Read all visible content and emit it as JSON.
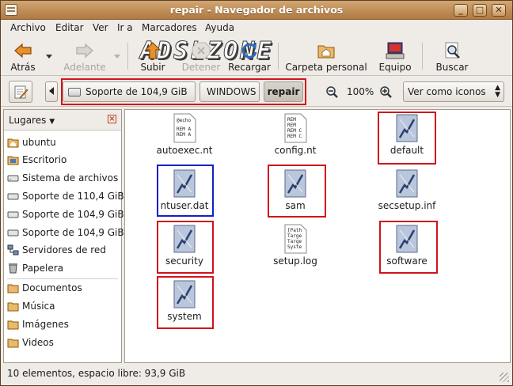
{
  "window": {
    "title": "repair - Navegador de archivos"
  },
  "watermark": "ADSLZONE",
  "menubar": {
    "items": [
      {
        "label": "Archivo"
      },
      {
        "label": "Editar"
      },
      {
        "label": "Ver"
      },
      {
        "label": "Ir a"
      },
      {
        "label": "Marcadores"
      },
      {
        "label": "Ayuda"
      }
    ]
  },
  "toolbar": {
    "back": "Atrás",
    "forward": "Adelante",
    "up": "Subir",
    "stop": "Detener",
    "reload": "Recargar",
    "home": "Carpeta personal",
    "computer": "Equipo",
    "search": "Buscar"
  },
  "location": {
    "path": [
      {
        "label": "Soporte de 104,9 GiB"
      },
      {
        "label": "WINDOWS"
      },
      {
        "label": "repair"
      }
    ],
    "zoom": "100%",
    "view_mode": "Ver como iconos"
  },
  "sidebar": {
    "header": "Lugares",
    "items": [
      {
        "label": "ubuntu",
        "icon": "home-folder-icon"
      },
      {
        "label": "Escritorio",
        "icon": "desktop-icon"
      },
      {
        "label": "Sistema de archivos",
        "icon": "drive-icon"
      },
      {
        "label": "Soporte de 110,4 GiB",
        "icon": "drive-icon"
      },
      {
        "label": "Soporte de 104,9 GiB",
        "icon": "drive-icon"
      },
      {
        "label": "Soporte de 104,9 GiB",
        "icon": "drive-icon"
      },
      {
        "label": "Servidores de red",
        "icon": "network-icon"
      },
      {
        "label": "Papelera",
        "icon": "trash-icon"
      },
      {
        "label": "Documentos",
        "icon": "folder-icon"
      },
      {
        "label": "Música",
        "icon": "folder-icon"
      },
      {
        "label": "Imágenes",
        "icon": "folder-icon"
      },
      {
        "label": "Videos",
        "icon": "folder-icon"
      }
    ]
  },
  "files": [
    {
      "name": "autoexec.nt",
      "type": "text",
      "preview": "@echo|REM A|REM A"
    },
    {
      "name": "config.nt",
      "type": "text",
      "preview": "REM|REM|REM C|REM C"
    },
    {
      "name": "default",
      "type": "hive"
    },
    {
      "name": "ntuser.dat",
      "type": "hive"
    },
    {
      "name": "sam",
      "type": "hive"
    },
    {
      "name": "secsetup.inf",
      "type": "hive"
    },
    {
      "name": "security",
      "type": "hive"
    },
    {
      "name": "setup.log",
      "type": "text",
      "preview": "[Path|Targe|Targe|Syste"
    },
    {
      "name": "software",
      "type": "hive"
    },
    {
      "name": "system",
      "type": "hive"
    }
  ],
  "status": "10 elementos, espacio libre: 93,9 GiB",
  "colors": {
    "highlight_red": "#d0141b",
    "highlight_blue": "#1120c4",
    "titlebar": "#c08a52"
  }
}
